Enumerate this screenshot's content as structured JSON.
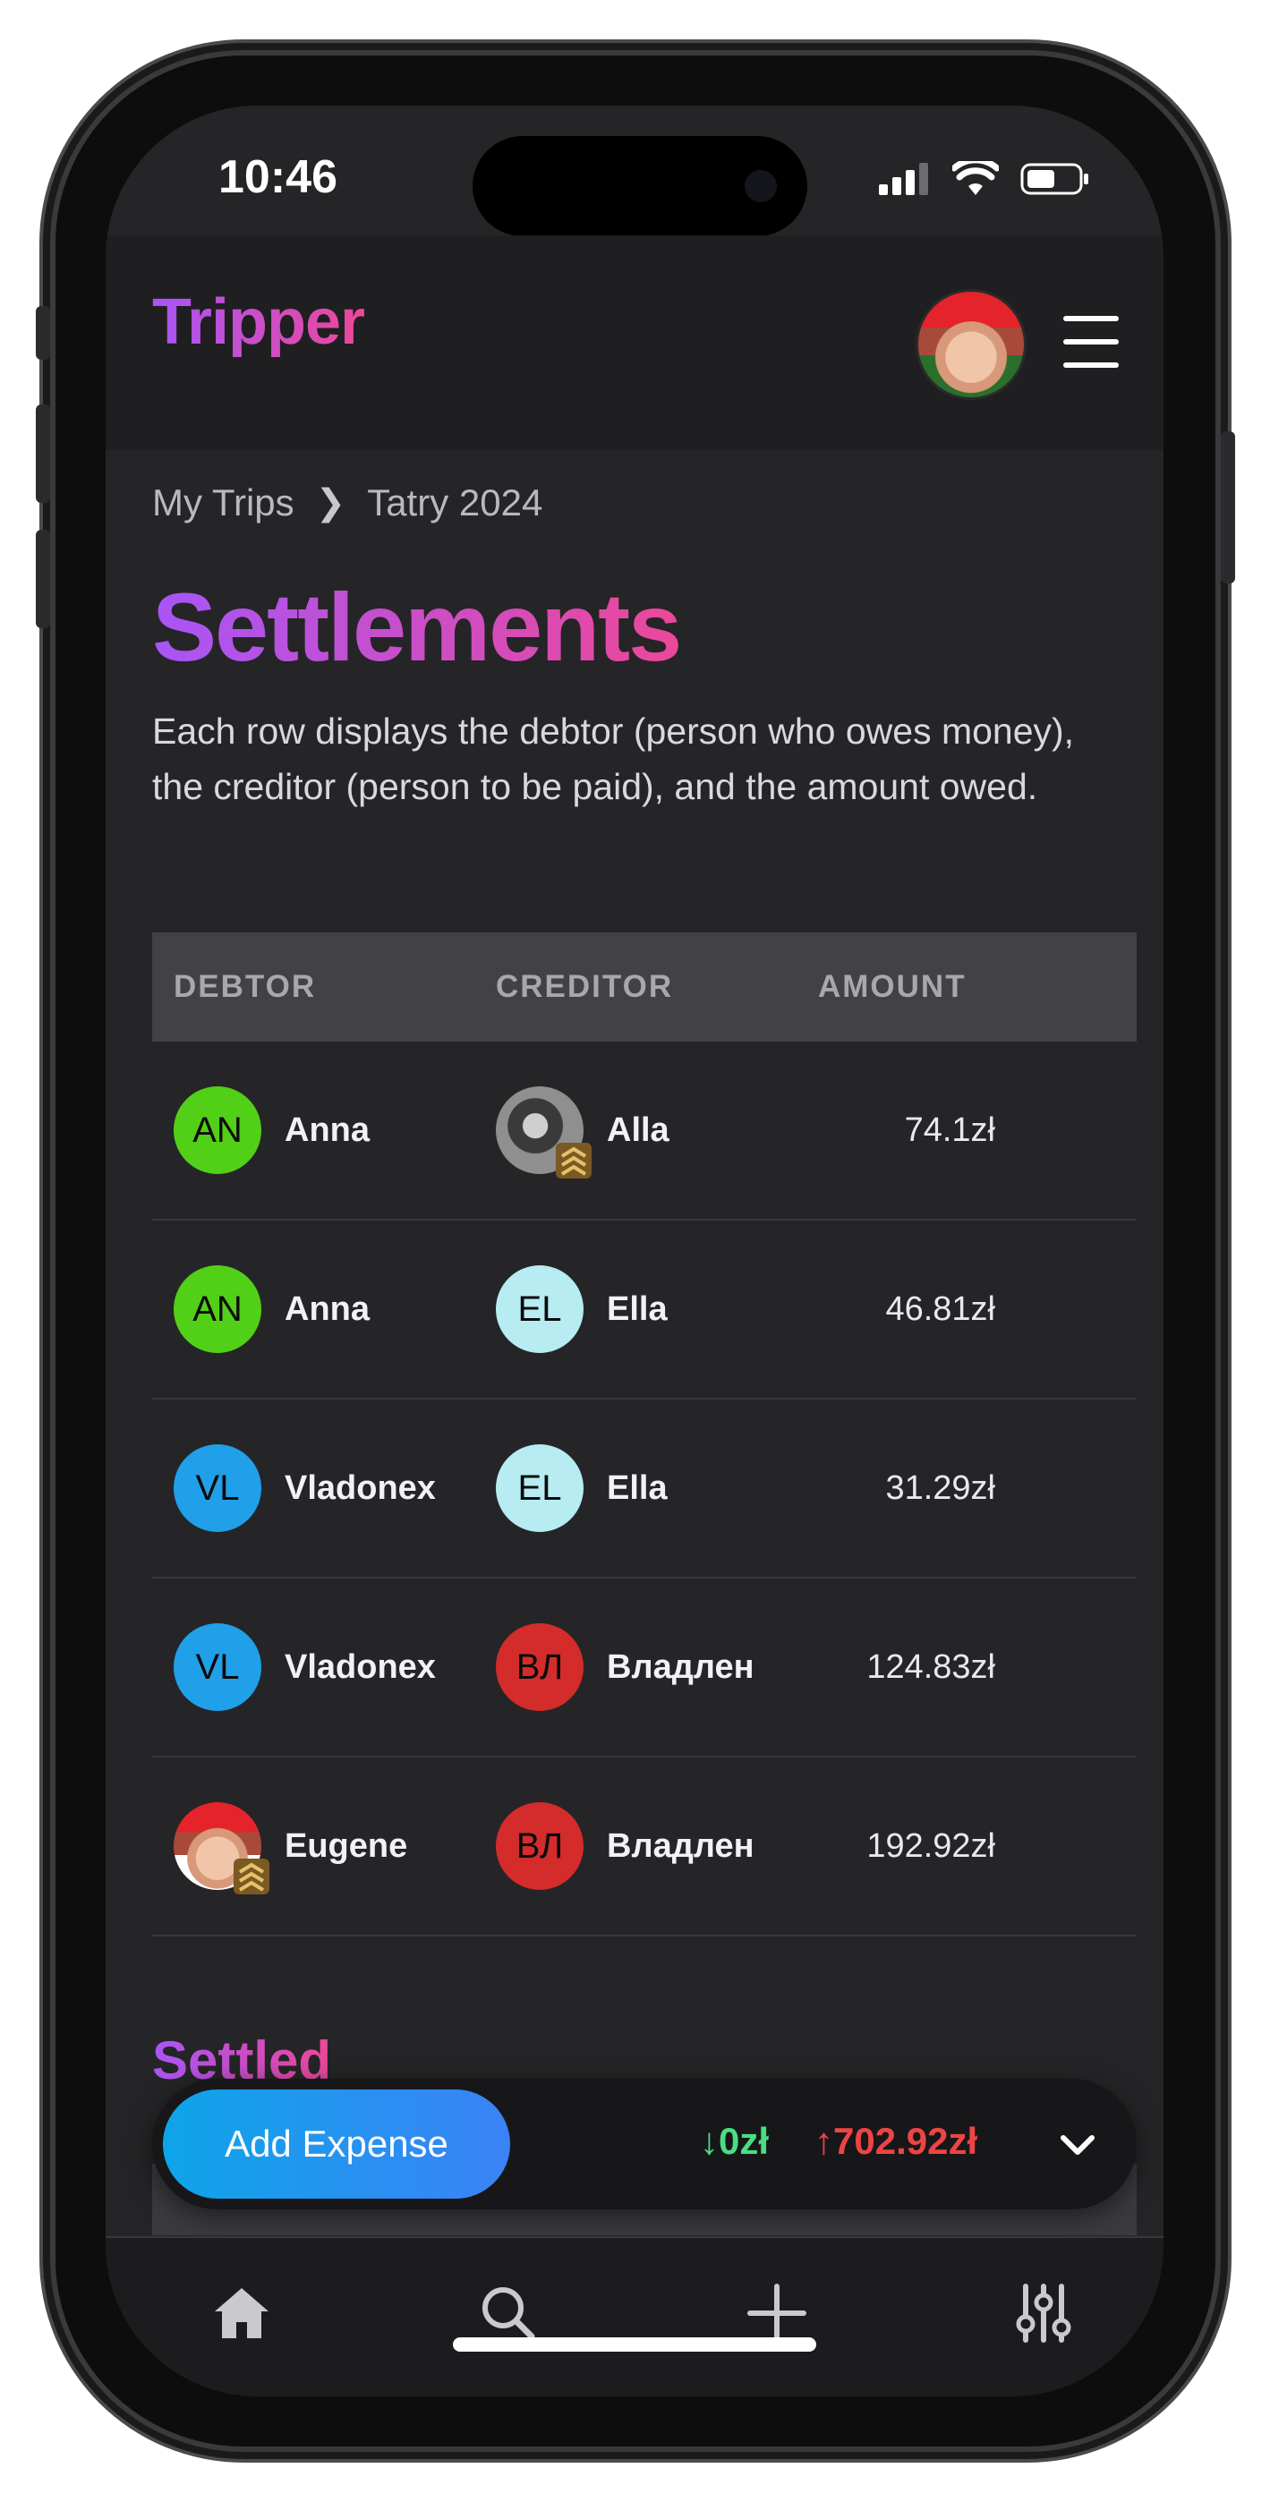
{
  "status_bar": {
    "time": "10:46"
  },
  "app": {
    "logo": "Tripper"
  },
  "breadcrumb": {
    "root": "My Trips",
    "current": "Tatry 2024"
  },
  "page": {
    "title": "Settlements",
    "description": "Each row displays the debtor (person who owes money), the creditor (person to be paid), and the amount owed."
  },
  "table": {
    "headers": {
      "debtor": "DEBTOR",
      "creditor": "CREDITOR",
      "amount": "AMOUNT"
    },
    "rows": [
      {
        "debtor": {
          "name": "Anna",
          "initials": "AN",
          "color": "#52d017"
        },
        "creditor": {
          "name": "Alla",
          "initials": "",
          "photo": true
        },
        "amount": "74.1zł"
      },
      {
        "debtor": {
          "name": "Anna",
          "initials": "AN",
          "color": "#52d017"
        },
        "creditor": {
          "name": "Ella",
          "initials": "EL",
          "color": "#b6ecf2"
        },
        "amount": "46.81zł"
      },
      {
        "debtor": {
          "name": "Vladonex",
          "initials": "VL",
          "color": "#1fa0e8"
        },
        "creditor": {
          "name": "Ella",
          "initials": "EL",
          "color": "#b6ecf2"
        },
        "amount": "31.29zł"
      },
      {
        "debtor": {
          "name": "Vladonex",
          "initials": "VL",
          "color": "#1fa0e8"
        },
        "creditor": {
          "name": "Владлен",
          "initials": "ВЛ",
          "color": "#d42b2b"
        },
        "amount": "124.83zł"
      },
      {
        "debtor": {
          "name": "Eugene",
          "initials": "",
          "photo": true
        },
        "creditor": {
          "name": "Владлен",
          "initials": "ВЛ",
          "color": "#d42b2b"
        },
        "amount": "192.92zł"
      }
    ]
  },
  "sections": {
    "settled_title": "Settled"
  },
  "footer_bar": {
    "add_expense_label": "Add Expense",
    "balance_in": "↓0zł",
    "balance_out": "↑702.92zł"
  },
  "nav": {
    "items": [
      "home-icon",
      "search-icon",
      "plus-icon",
      "settings-sliders-icon"
    ]
  },
  "colors": {
    "accent_gradient_start": "#a855f7",
    "accent_gradient_end": "#ec4899",
    "positive": "#4ade80",
    "negative": "#ef4444"
  }
}
